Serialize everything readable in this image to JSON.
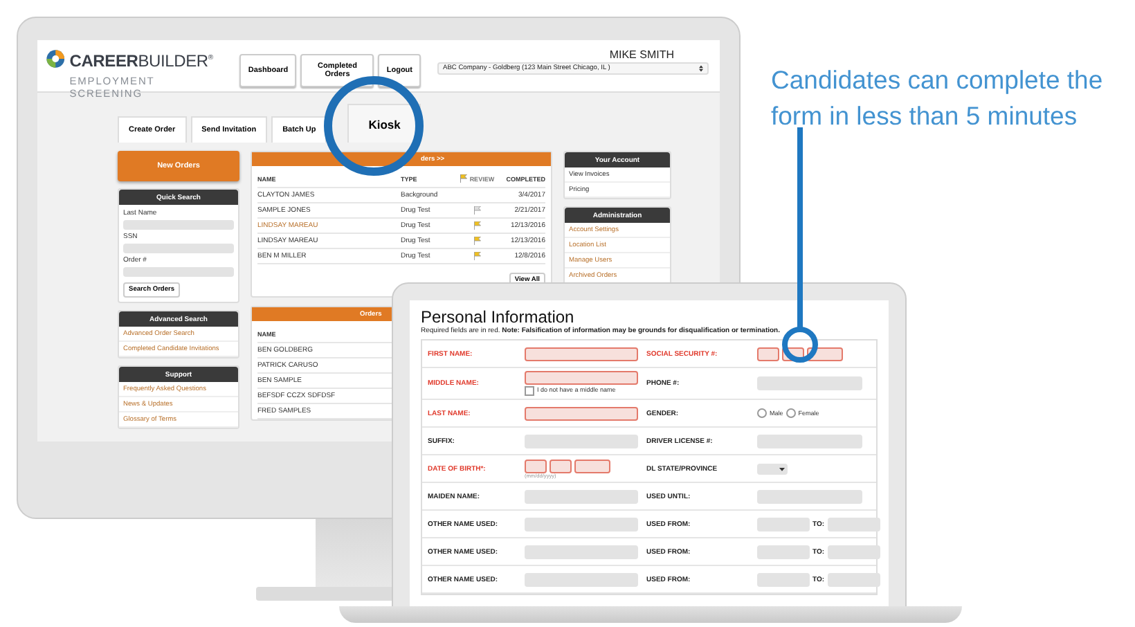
{
  "callout": "Candidates can complete the form in less than 5 minutes",
  "app": {
    "logo": {
      "brand": "**CAREER**BUILDER$^{®}$",
      "subtitle": "EMPLOYMENT SCREENING"
    },
    "nav_buttons": [
      "Dashboard",
      "Completed Orders",
      "Logout"
    ],
    "user_name": "MIKE SMITH",
    "company_select": "ABC Company - Goldberg (123 Main Street Chicago, IL )",
    "tabs": [
      {
        "label": "Create Order",
        "selected": false
      },
      {
        "label": "Send Invitation",
        "selected": false
      },
      {
        "label": "Batch Up",
        "selected": false
      },
      {
        "label": "Kiosk",
        "selected": true
      }
    ],
    "new_orders_button": "New Orders",
    "quick_search": {
      "title": "Quick Search",
      "fields": [
        "Last Name",
        "SSN",
        "Order #"
      ],
      "button": "Search Orders"
    },
    "advanced_search": {
      "title": "Advanced Search",
      "links": [
        "Advanced Order Search",
        "Completed Candidate Invitations"
      ]
    },
    "support": {
      "title": "Support",
      "links": [
        "Frequently Asked Questions",
        "News & Updates",
        "Glossary of Terms"
      ]
    },
    "orders_panel": {
      "header": "ders >>",
      "columns": [
        "NAME",
        "TYPE",
        "REVIEW",
        "COMPLETED"
      ],
      "rows": [
        {
          "name": "CLAYTON JAMES",
          "type": "Background",
          "flagged": false,
          "completed": "3/4/2017",
          "highlighted": false
        },
        {
          "name": "SAMPLE JONES",
          "type": "Drug Test",
          "flagged": true,
          "color": "#dddddd",
          "completed": "2/21/2017",
          "highlighted": false
        },
        {
          "name": "LINDSAY MAREAU",
          "type": "Drug Test",
          "flagged": true,
          "color": "#f0c020",
          "completed": "12/13/2016",
          "highlighted": true
        },
        {
          "name": "LINDSAY MAREAU",
          "type": "Drug Test",
          "flagged": true,
          "color": "#f0c020",
          "completed": "12/13/2016",
          "highlighted": false
        },
        {
          "name": "BEN M MILLER",
          "type": "Drug Test",
          "flagged": true,
          "color": "#f0c020",
          "completed": "12/8/2016",
          "highlighted": false
        }
      ],
      "button": "View All"
    },
    "orders_panel_2": {
      "header": "Orders",
      "column": "NAME",
      "rows": [
        "BEN GOLDBERG",
        "PATRICK CARUSO",
        "BEN SAMPLE",
        "BEFSDF CCZX SDFDSF",
        "FRED SAMPLES"
      ]
    },
    "your_account": {
      "title": "Your Account",
      "links": [
        "View Invoices",
        "Pricing"
      ]
    },
    "administration": {
      "title": "Administration",
      "links": [
        "Account Settings",
        "Location List",
        "Manage Users",
        "Archived Orders"
      ]
    }
  },
  "form": {
    "title": "Personal Information",
    "note": "Required fields are in red. **Note: Falsification of information may be grounds for disqualification or termination.**",
    "rows": [
      [
        {
          "label": "FIRST NAME:",
          "required": true,
          "kind": "text"
        },
        {
          "label": "SOCIAL SECURITY #:",
          "required": true,
          "kind": "ssn"
        }
      ],
      [
        {
          "label": "MIDDLE NAME:",
          "required": true,
          "kind": "text_checkbox",
          "checkbox": {
            "label": "I do not have a middle name",
            "checked": false
          }
        },
        {
          "label": "PHONE #:",
          "required": false,
          "kind": "text"
        }
      ],
      [
        {
          "label": "LAST NAME:",
          "required": true,
          "kind": "text"
        },
        {
          "label": "GENDER:",
          "required": false,
          "kind": "radio",
          "options": [
            {
              "label": "Male",
              "selected": false
            },
            {
              "label": "Female",
              "selected": false
            }
          ]
        }
      ],
      [
        {
          "label": "SUFFIX:",
          "required": false,
          "kind": "text"
        },
        {
          "label": "DRIVER LICENSE #:",
          "required": false,
          "kind": "text"
        }
      ],
      [
        {
          "label": "DATE OF BIRTH*:",
          "required": true,
          "kind": "date",
          "hint": "(mm/dd/yyyy)"
        },
        {
          "label": "DL STATE/PROVINCE",
          "required": false,
          "kind": "select"
        }
      ],
      [
        {
          "label": "MAIDEN NAME:",
          "required": false,
          "kind": "text"
        },
        {
          "label": "USED UNTIL:",
          "required": false,
          "kind": "text"
        }
      ],
      [
        {
          "label": "OTHER NAME USED:",
          "required": false,
          "kind": "text"
        },
        {
          "label": "USED FROM:",
          "required": false,
          "kind": "range",
          "to_label": "TO:"
        }
      ],
      [
        {
          "label": "OTHER NAME USED:",
          "required": false,
          "kind": "text"
        },
        {
          "label": "USED FROM:",
          "required": false,
          "kind": "range",
          "to_label": "TO:"
        }
      ],
      [
        {
          "label": "OTHER NAME USED:",
          "required": false,
          "kind": "text"
        },
        {
          "label": "USED FROM:",
          "required": false,
          "kind": "range",
          "to_label": "TO:"
        }
      ]
    ]
  }
}
